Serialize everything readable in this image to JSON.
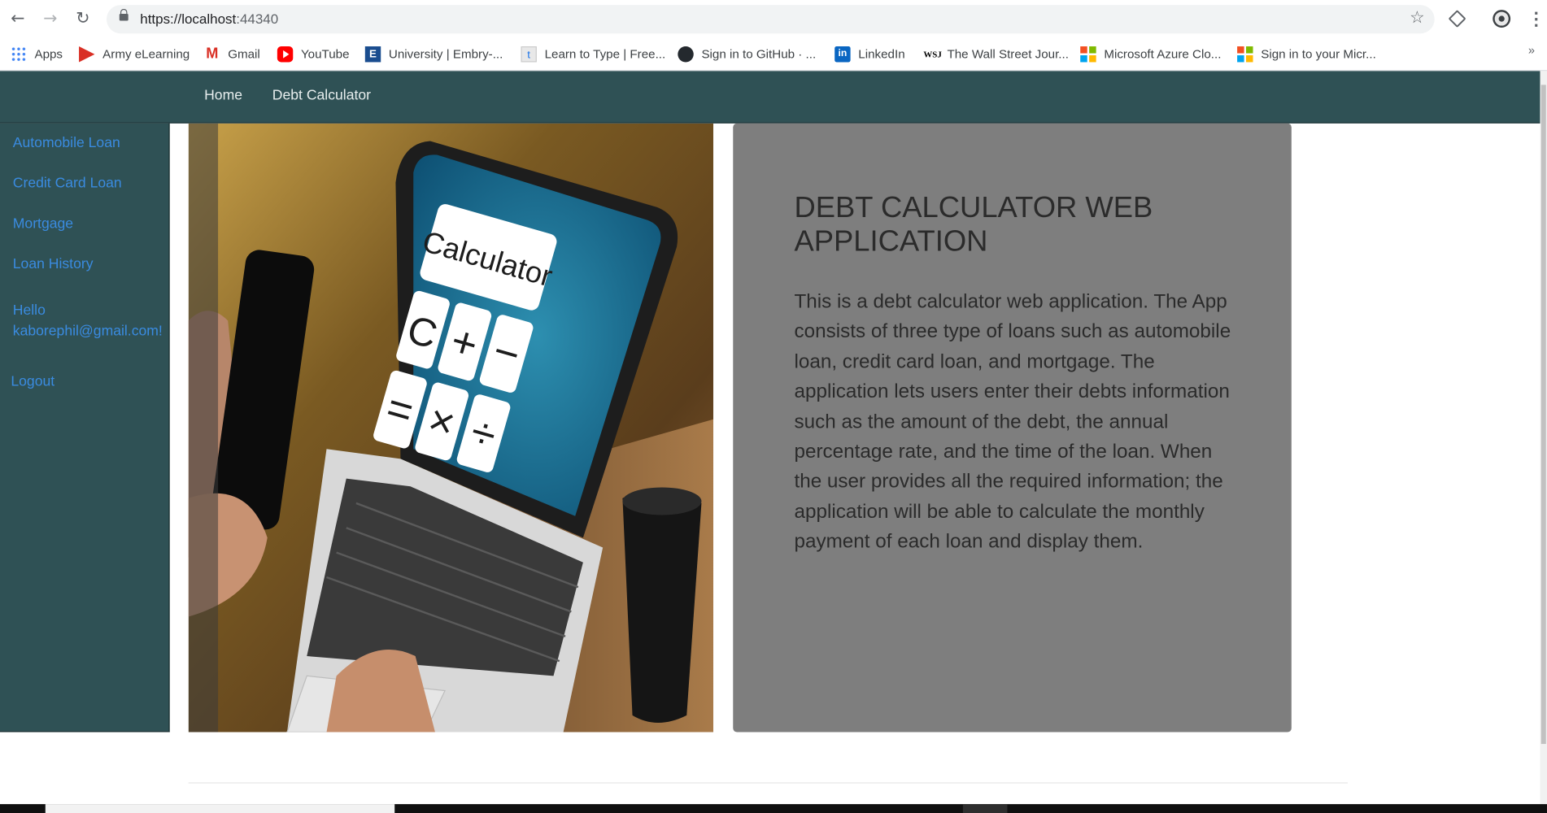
{
  "browser": {
    "url_host": "https://localhost",
    "url_rest": ":44340",
    "nav_icons": [
      "back-arrow-icon",
      "forward-arrow-icon",
      "reload-icon"
    ],
    "bookmarks": [
      {
        "label": "Apps",
        "icon": "apps-grid-icon"
      },
      {
        "label": "Army eLearning",
        "icon": "army-icon"
      },
      {
        "label": "Gmail",
        "icon": "gmail-icon"
      },
      {
        "label": "YouTube",
        "icon": "youtube-icon"
      },
      {
        "label": "University | Embry-...",
        "icon": "university-icon"
      },
      {
        "label": "Learn to Type | Free...",
        "icon": "typing-icon"
      },
      {
        "label": "Sign in to GitHub · ...",
        "icon": "github-icon"
      },
      {
        "label": "LinkedIn",
        "icon": "linkedin-icon"
      },
      {
        "label": "The Wall Street Jour...",
        "icon": "wsj-icon"
      },
      {
        "label": "Microsoft Azure Clo...",
        "icon": "microsoft-icon"
      },
      {
        "label": "Sign in to your Micr...",
        "icon": "microsoft-icon"
      }
    ],
    "more_bookmarks": "»"
  },
  "topnav": {
    "home": "Home",
    "debt_calculator": "Debt Calculator"
  },
  "sidebar": {
    "items": [
      {
        "label": "Automobile Loan"
      },
      {
        "label": "Credit Card Loan"
      },
      {
        "label": "Mortgage"
      },
      {
        "label": "Loan History"
      }
    ],
    "greeting_line1": "Hello",
    "greeting_line2": "kaborephil@gmail.com!",
    "logout": "Logout"
  },
  "hero": {
    "screen_title": "Calculator",
    "keys": [
      "C",
      "+",
      "−",
      "=",
      "×",
      "÷"
    ]
  },
  "info": {
    "title": "DEBT CALCULATOR WEB APPLICATION",
    "body": "This is a debt calculator web application. The App consists of three type of loans such as automobile loan, credit card loan, and mortgage. The application lets users enter their debts information such as the amount of the debt, the annual percentage rate, and the time of the loan. When the user provides all the required information; the application will be able to calculate the monthly payment of each loan and display them."
  },
  "colors": {
    "nav_bg": "#2f5155",
    "link": "#3a8be0",
    "card_bg": "#7e7e7e",
    "card_text": "#2b2b2b"
  }
}
